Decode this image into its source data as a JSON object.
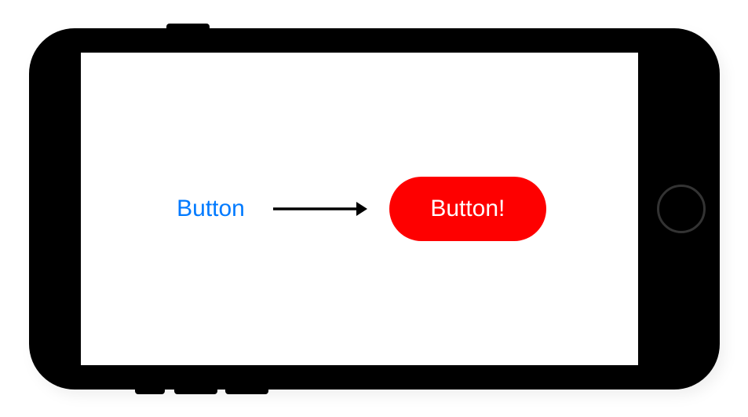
{
  "device": {
    "type": "phone",
    "orientation": "landscape"
  },
  "content": {
    "plain_button_label": "Button",
    "styled_button_label": "Button!"
  },
  "colors": {
    "plain_button_text": "#007AFF",
    "styled_button_bg": "#FE0000",
    "styled_button_text": "#FFFFFF",
    "arrow": "#000000"
  }
}
